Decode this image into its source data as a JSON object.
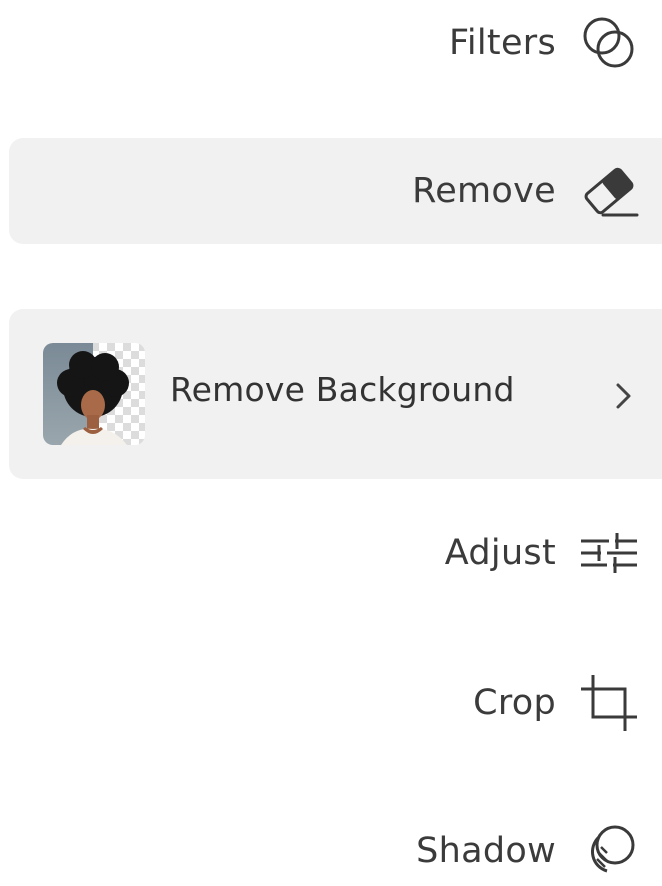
{
  "menu": {
    "filters": {
      "label": "Filters",
      "icon": "filters-icon"
    },
    "remove": {
      "label": "Remove",
      "icon": "eraser-icon"
    },
    "remove_background": {
      "label": "Remove Background",
      "thumbnail": "portrait-thumbnail",
      "chevron": "chevron-right-icon"
    },
    "adjust": {
      "label": "Adjust",
      "icon": "sliders-icon"
    },
    "crop": {
      "label": "Crop",
      "icon": "crop-icon"
    },
    "shadow": {
      "label": "Shadow",
      "icon": "shadow-icon"
    }
  },
  "colors": {
    "text": "#3b3b3b",
    "panel_bg": "#f1f1f1",
    "icon_stroke": "#3a3a3a"
  }
}
